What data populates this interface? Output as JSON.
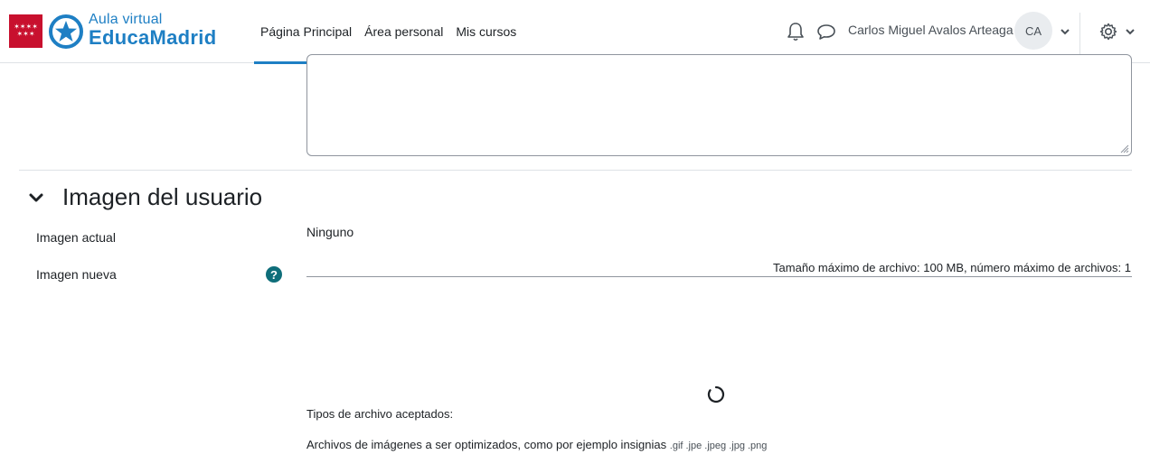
{
  "brand": {
    "subtitle": "Aula virtual",
    "name": "EducaMadrid",
    "flag_icon": "comunidad-madrid-flag-icon",
    "logo_icon": "educamadrid-star-logo-icon",
    "accent": "#1e7fc4"
  },
  "nav": {
    "items": [
      {
        "label": "Página Principal",
        "active": true
      },
      {
        "label": "Área personal",
        "active": false
      },
      {
        "label": "Mis cursos",
        "active": false
      }
    ]
  },
  "user": {
    "name": "Carlos Miguel Avalos Arteaga",
    "initials": "CA"
  },
  "icons": {
    "notifications": "bell-icon",
    "messages": "chat-bubble-icon",
    "user_menu": "chevron-down-icon",
    "settings": "gear-icon"
  },
  "section": {
    "title": "Imagen del usuario",
    "collapse_icon": "chevron-down-icon"
  },
  "fields": {
    "current_image_label": "Imagen actual",
    "current_image_value": "Ninguno",
    "new_image_label": "Imagen nueva",
    "help_icon": "question-circle-icon",
    "help_color": "#0f6e7a",
    "file_limit": "Tamaño máximo de archivo: 100 MB, número máximo de archivos: 1"
  },
  "accepted": {
    "label": "Tipos de archivo aceptados:",
    "description": "Archivos de imágenes a ser optimizados, como por ejemplo insignias",
    "extensions": ".gif .jpe .jpeg .jpg .png"
  }
}
